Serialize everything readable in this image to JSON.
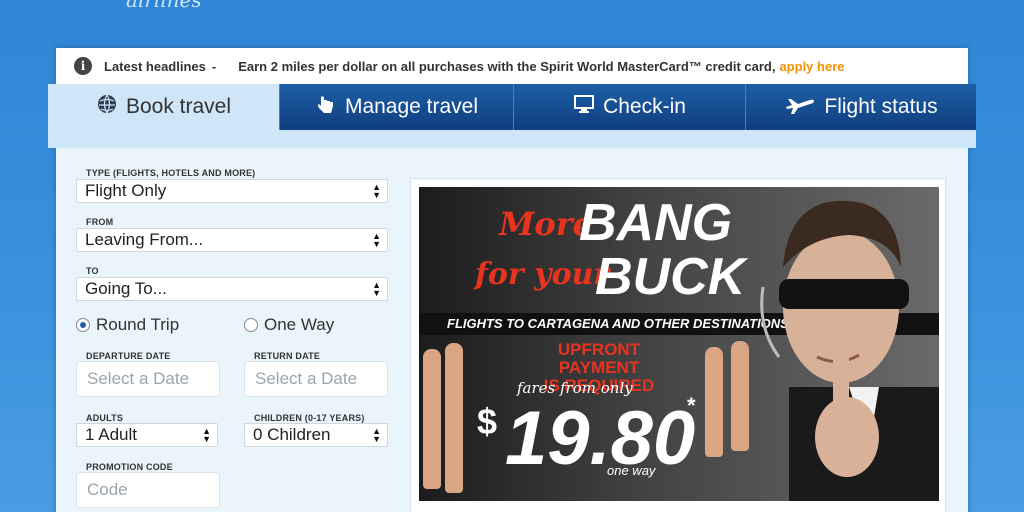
{
  "logo": {
    "fragment": "airlines"
  },
  "headline": {
    "label": "Latest headlines",
    "dash": "-",
    "text": "Earn 2 miles per dollar on all purchases with the Spirit World MasterCard™ credit card,",
    "link": "apply here",
    "link_color": "#f39200"
  },
  "tabs": [
    {
      "label": "Book travel",
      "icon": "globe-icon",
      "active": true
    },
    {
      "label": "Manage travel",
      "icon": "hand-pointer-icon",
      "active": false
    },
    {
      "label": "Check-in",
      "icon": "monitor-icon",
      "active": false
    },
    {
      "label": "Flight status",
      "icon": "airplane-icon",
      "active": false
    }
  ],
  "form": {
    "type_label": "TYPE (FLIGHTS, HOTELS AND MORE)",
    "type_value": "Flight Only",
    "from_label": "FROM",
    "from_value": "Leaving From...",
    "to_label": "TO",
    "to_value": "Going To...",
    "trip_options": [
      "Round Trip",
      "One Way"
    ],
    "trip_selected": "Round Trip",
    "departure_label": "DEPARTURE DATE",
    "departure_placeholder": "Select a Date",
    "return_label": "RETURN DATE",
    "return_placeholder": "Select a Date",
    "adults_label": "ADULTS",
    "adults_value": "1 Adult",
    "children_label": "CHILDREN (0-17 YEARS)",
    "children_value": "0 Children",
    "promo_label": "PROMOTION CODE",
    "promo_placeholder": "Code"
  },
  "ad": {
    "more": "More",
    "bang": "BANG",
    "for_your": "for your",
    "buck": "BUCK",
    "strip": "FLIGHTS TO CARTAGENA AND OTHER DESTINATIONS",
    "upfront_line1": "UPFRONT PAYMENT",
    "upfront_line2": "IS REQUIRED",
    "fares_from": "fares from only",
    "dollar": "$",
    "price": "19.80",
    "asterisk": "*",
    "one_way": "one way",
    "accent_color": "#e8341f"
  }
}
